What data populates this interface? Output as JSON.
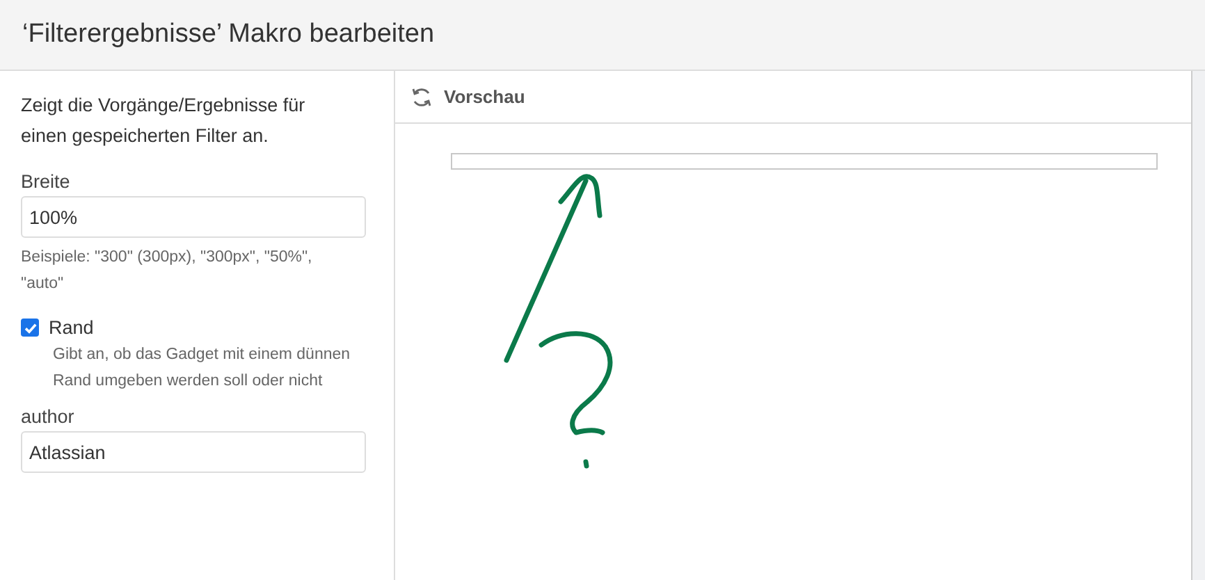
{
  "dialog": {
    "title": "‘Filterergebnisse’ Makro bearbeiten"
  },
  "form": {
    "description": "Zeigt die Vorgänge/Ergebnisse für einen gespeicherten Filter an.",
    "fields": [
      {
        "kind": "text",
        "label": "Breite",
        "value": "100%",
        "hint": "Beispiele: \"300\" (300px), \"300px\", \"50%\", \"auto\""
      },
      {
        "kind": "checkbox",
        "label": "Rand",
        "checked": true,
        "hint": "Gibt an, ob das Gadget mit einem dünnen Rand umgeben werden soll oder nicht"
      },
      {
        "kind": "text",
        "label": "author",
        "value": "Atlassian"
      }
    ]
  },
  "preview": {
    "title": "Vorschau"
  }
}
